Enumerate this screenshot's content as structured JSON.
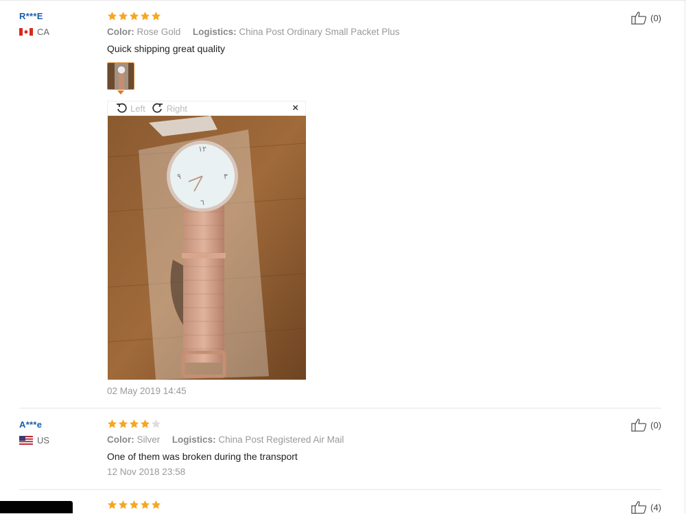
{
  "reviews": [
    {
      "user": "R***E",
      "country": "CA",
      "stars": 5,
      "color_label": "Color:",
      "color_value": "Rose Gold",
      "logistics_label": "Logistics:",
      "logistics_value": "China Post Ordinary Small Packet Plus",
      "text": "Quick shipping great quality",
      "date": "02 May 2019 14:45",
      "likes": "(0)"
    },
    {
      "user": "A***e",
      "country": "US",
      "stars": 4,
      "color_label": "Color:",
      "color_value": "Silver",
      "logistics_label": "Logistics:",
      "logistics_value": "China Post Registered Air Mail",
      "text": "One of them was broken during the transport",
      "date": "12 Nov 2018 23:58",
      "likes": "(0)"
    },
    {
      "stars": 5,
      "likes": "(4)"
    }
  ],
  "viewer": {
    "rotate_left": "Left",
    "rotate_right": "Right",
    "close": "×"
  },
  "colors": {
    "star_on": "#f5a623",
    "star_off": "#dddddd",
    "user_name": "#1a5ea8",
    "thumb_border": "#e08a2e"
  }
}
